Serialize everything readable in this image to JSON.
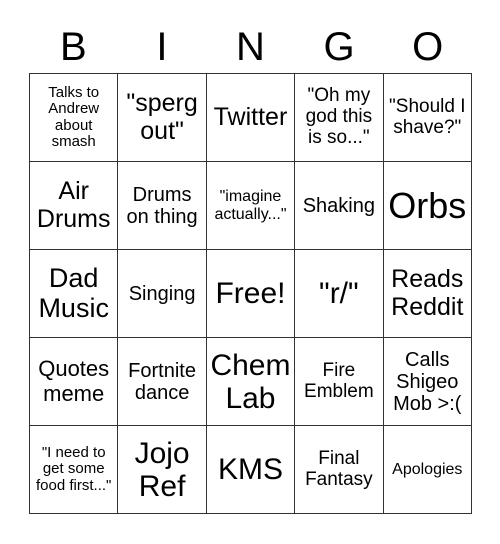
{
  "header": {
    "letters": [
      "B",
      "I",
      "N",
      "G",
      "O"
    ]
  },
  "board": {
    "rows": [
      [
        "Talks to Andrew about smash",
        "\"sperg out\"",
        "Twitter",
        "\"Oh my god this is so...\"",
        "\"Should I shave?\""
      ],
      [
        "Air Drums",
        "Drums on thing",
        "\"imagine actually...\"",
        "Shaking",
        "Orbs"
      ],
      [
        "Dad Music",
        "Singing",
        "Free!",
        "\"r/\"",
        "Reads Reddit"
      ],
      [
        "Quotes meme",
        "Fortnite dance",
        "Chem Lab",
        "Fire Emblem",
        "Calls Shigeo Mob >:("
      ],
      [
        "\"I need to get some food first...\"",
        "Jojo Ref",
        "KMS",
        "Final Fantasy",
        "Apologies"
      ]
    ]
  }
}
